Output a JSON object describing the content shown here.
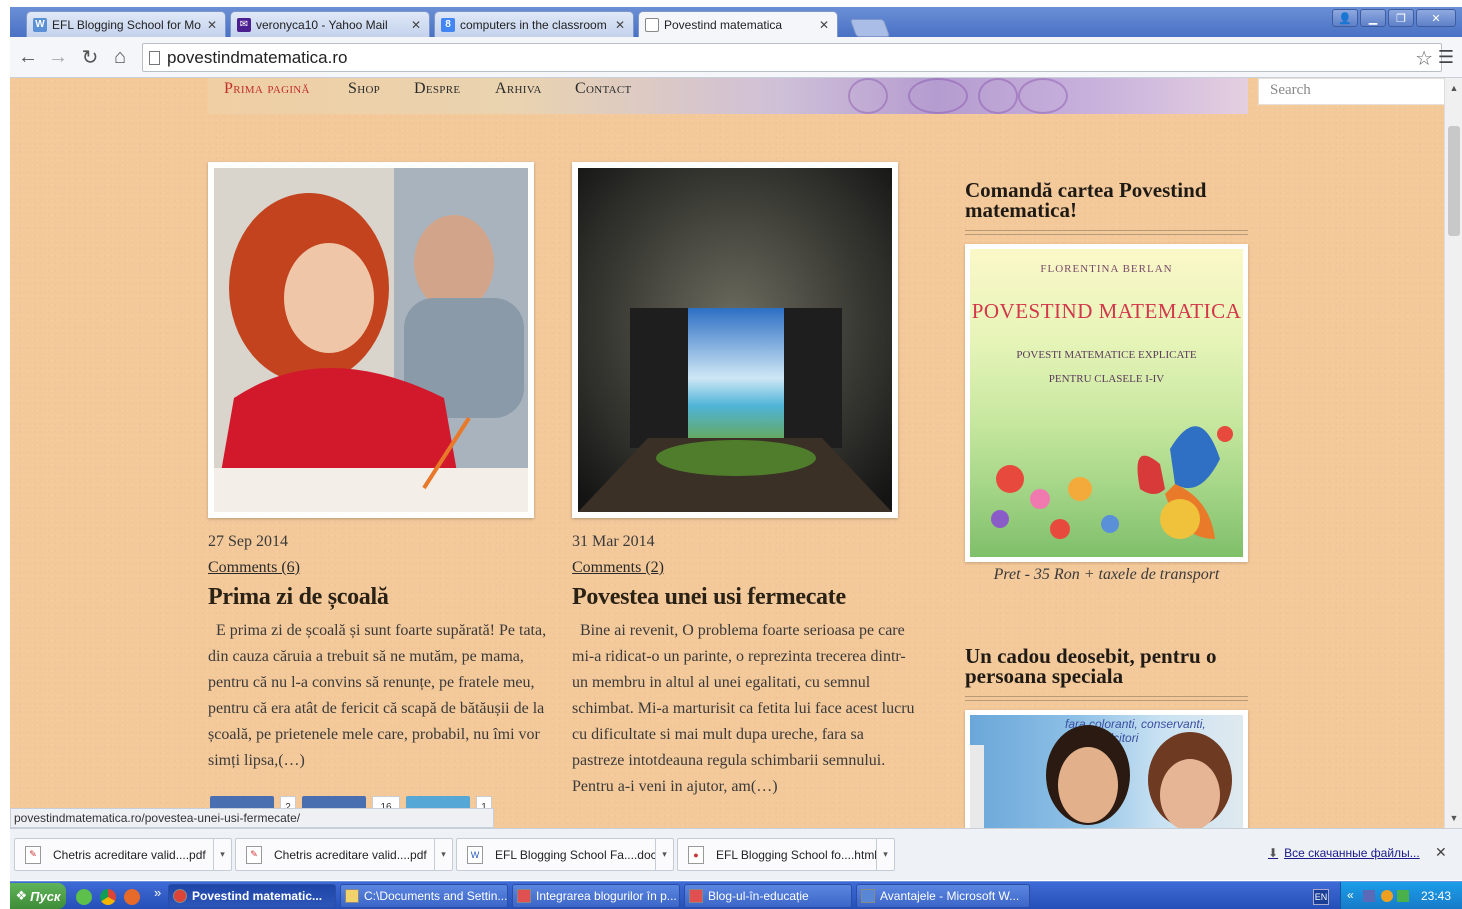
{
  "browser": {
    "tabs": [
      {
        "title": "EFL Blogging School for Mold",
        "icon": "wordpress-icon"
      },
      {
        "title": "veronyca10 - Yahoo Mail",
        "icon": "mail-icon"
      },
      {
        "title": "computers in the classroom -",
        "icon": "google-icon"
      },
      {
        "title": "Povestind matematica",
        "icon": "page-icon"
      }
    ],
    "url": "povestindmatematica.ro"
  },
  "site": {
    "nav": [
      "Prima pagină",
      "Shop",
      "Despre",
      "Arhiva",
      "Contact"
    ],
    "search_placeholder": "Search",
    "posts": [
      {
        "date": "27 Sep 2014",
        "comments": "Comments (6)",
        "title": "Prima zi de școală",
        "excerpt": "E prima zi de școală și sunt foarte supărată! Pe tata, din cauza căruia a trebuit să ne mutăm, pe mama, pentru că nu l-a convins să renunțe, pe fratele meu, pentru că era atât de fericit că scapă de bătăușii de la școală, pe prietenele mele care, probabil, nu îmi vor simți lipsa,(…)"
      },
      {
        "date": "31 Mar 2014",
        "comments": "Comments (2)",
        "title": "Povestea unei usi fermecate",
        "excerpt": "Bine ai revenit, O problema foarte serioasa pe care mi-a ridicat-o un parinte, o reprezinta trecerea dintr-un membru in altul al unei egalitati, cu semnul schimbat. Mi-a marturisit ca fetita lui face acest lucru cu dificultate si mai mult dupa ureche, fara sa pastreze intotdeauna regula schimbarii semnului. Pentru a-i veni in ajutor, am(…)"
      }
    ],
    "share_counts": [
      "2",
      "16",
      "1"
    ],
    "sidebar": {
      "widget1_title": "Comandă cartea Povestind matematica!",
      "book_author": "FLORENTINA BERLAN",
      "book_title": "POVESTIND MATEMATICA",
      "book_subtitle1": "POVESTI MATEMATICE EXPLICATE",
      "book_subtitle2": "PENTRU CLASELE I-IV",
      "price": "Pret - 35 Ron + taxele de transport",
      "widget2_title": "Un cadou deosebit, pentru o persoana speciala",
      "photo_caption": "fara coloranti, conservanti, sau indulcitori"
    }
  },
  "status_url": "povestindmatematica.ro/povestea-unei-usi-fermecate/",
  "downloads": {
    "items": [
      "Chetris acreditare valid....pdf",
      "Chetris acreditare valid....pdf",
      "EFL Blogging School Fa....doc",
      "EFL Blogging School fo....html"
    ],
    "show_all": "Все скачанные файлы..."
  },
  "taskbar": {
    "start": "Пуск",
    "buttons": [
      "Povestind matematic...",
      "C:\\Documents and Settin...",
      "Integrarea blogurilor în p...",
      "Blog-ul-în-educație",
      "Avantajele - Microsoft W..."
    ],
    "lang": "EN",
    "clock": "23:43"
  }
}
